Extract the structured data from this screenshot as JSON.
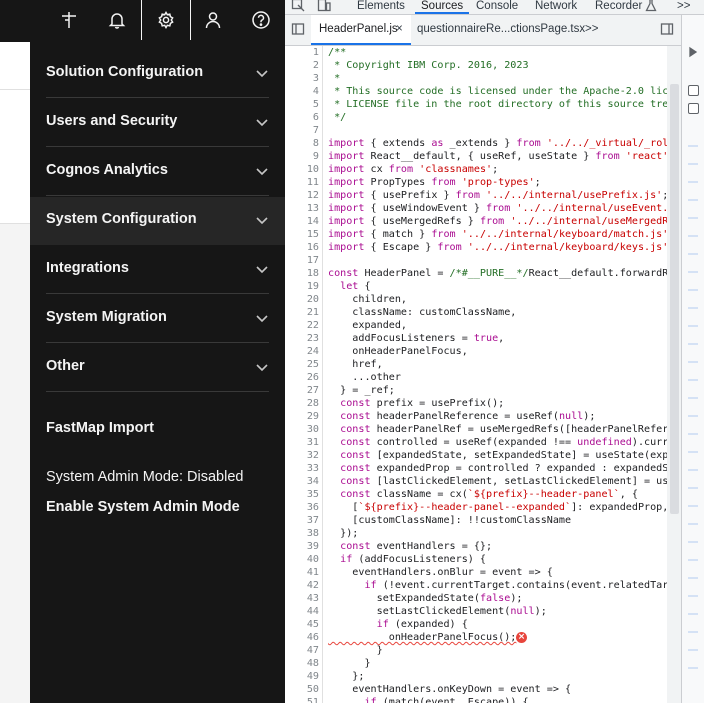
{
  "menu": {
    "items": [
      {
        "label": "Solution Configuration"
      },
      {
        "label": "Users and Security"
      },
      {
        "label": "Cognos Analytics"
      },
      {
        "label": "System Configuration"
      },
      {
        "label": "Integrations"
      },
      {
        "label": "System Migration"
      },
      {
        "label": "Other"
      }
    ],
    "fastmap": "FastMap Import",
    "admin_mode_status": "System Admin Mode: Disabled",
    "enable_admin_mode": "Enable System Admin Mode"
  },
  "devtools": {
    "tabs": [
      "Elements",
      "Sources",
      "Console",
      "Network",
      "Recorder"
    ],
    "more": ">>",
    "file_tabs": [
      {
        "label": "HeaderPanel.js",
        "close": "×"
      },
      {
        "label": "questionnaireRe...ctionsPage.tsx"
      }
    ],
    "file_more": ">>",
    "line_numbers": [
      "1",
      "2",
      "3",
      "4",
      "5",
      "6",
      "7",
      "8",
      "9",
      "10",
      "11",
      "12",
      "13",
      "14",
      "15",
      "16",
      "17",
      "18",
      "19",
      "20",
      "21",
      "22",
      "23",
      "24",
      "25",
      "26",
      "27",
      "28",
      "29",
      "30",
      "31",
      "32",
      "33",
      "34",
      "35",
      "36",
      "37",
      "38",
      "39",
      "40",
      "41",
      "42",
      "43",
      "44",
      "45",
      "46",
      "47",
      "48",
      "49",
      "50",
      "51"
    ],
    "code_lines": [
      "/**",
      " * Copyright IBM Corp. 2016, 2023",
      " *",
      " * This source code is licensed under the Apache-2.0 lice",
      " * LICENSE file in the root directory of this source tree",
      " */",
      "",
      "import { extends as _extends } from '../../_virtual/_roll",
      "import React__default, { useRef, useState } from 'react';",
      "import cx from 'classnames';",
      "import PropTypes from 'prop-types';",
      "import { usePrefix } from '../../internal/usePrefix.js';",
      "import { useWindowEvent } from '../../internal/useEvent.j",
      "import { useMergedRefs } from '../../internal/useMergedRe",
      "import { match } from '../../internal/keyboard/match.js';",
      "import { Escape } from '../../internal/keyboard/keys.js';",
      "",
      "const HeaderPanel = /*#__PURE__*/React__default.forwardRe",
      "  let {",
      "    children,",
      "    className: customClassName,",
      "    expanded,",
      "    addFocusListeners = true,",
      "    onHeaderPanelFocus,",
      "    href,",
      "    ...other",
      "  } = _ref;",
      "  const prefix = usePrefix();",
      "  const headerPanelReference = useRef(null);",
      "  const headerPanelRef = useMergedRefs([headerPanelRefere",
      "  const controlled = useRef(expanded !== undefined).curre",
      "  const [expandedState, setExpandedState] = useState(expa",
      "  const expandedProp = controlled ? expanded : expandedSt",
      "  const [lastClickedElement, setLastClickedElement] = use",
      "  const className = cx(`${prefix}--header-panel`, {",
      "    [`${prefix}--header-panel--expanded`]: expandedProp,",
      "    [customClassName]: !!customClassName",
      "  });",
      "  const eventHandlers = {};",
      "  if (addFocusListeners) {",
      "    eventHandlers.onBlur = event => {",
      "      if (!event.currentTarget.contains(event.relatedTarg",
      "        setExpandedState(false);",
      "        setLastClickedElement(null);",
      "        if (expanded) {",
      "          onHeaderPanelFocus();",
      "        }",
      "      }",
      "    };",
      "    eventHandlers.onKeyDown = event => {",
      "      if (match(event, Escape)) {"
    ],
    "error_icon": "×"
  }
}
